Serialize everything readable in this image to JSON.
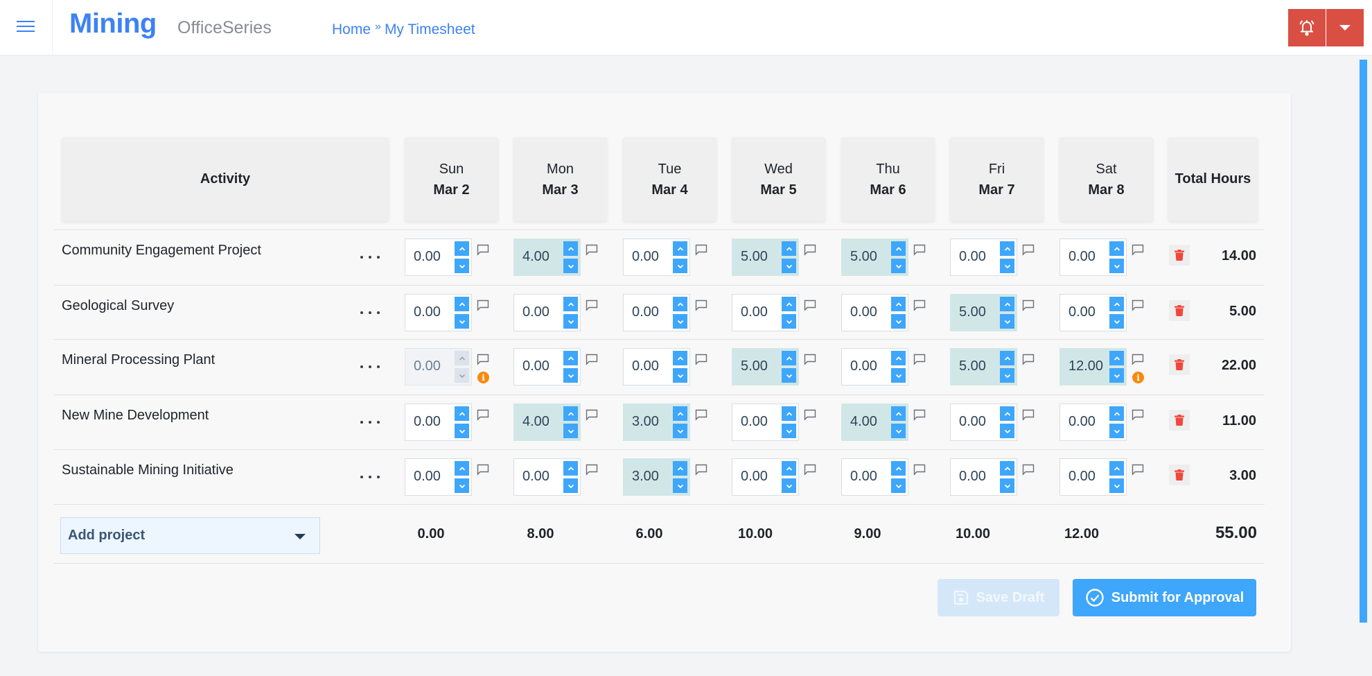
{
  "header": {
    "app_name": "Mining",
    "app_suffix": "OfficeSeries",
    "breadcrumb": [
      {
        "label": "Home"
      },
      {
        "label": "My Timesheet"
      }
    ],
    "breadcrumb_separator": "»",
    "menu_icon": "hamburger-icon",
    "alarm_icon": "alarm-bell-icon",
    "dropdown_icon": "caret-down-icon",
    "accent_color": "#3d82f5",
    "alert_color": "#d94f43"
  },
  "timesheet": {
    "columns": {
      "activity": "Activity",
      "total": "Total Hours",
      "days": [
        {
          "day": "Sun",
          "date": "Mar 2"
        },
        {
          "day": "Mon",
          "date": "Mar 3"
        },
        {
          "day": "Tue",
          "date": "Mar 4"
        },
        {
          "day": "Wed",
          "date": "Mar 5"
        },
        {
          "day": "Thu",
          "date": "Mar 6"
        },
        {
          "day": "Fri",
          "date": "Mar 7"
        },
        {
          "day": "Sat",
          "date": "Mar 8"
        }
      ]
    },
    "rows": [
      {
        "activity": "Community Engagement Project",
        "hours": [
          "0.00",
          "4.00",
          "0.00",
          "5.00",
          "5.00",
          "0.00",
          "0.00"
        ],
        "highlighted": [
          false,
          true,
          false,
          true,
          true,
          false,
          false
        ],
        "disabled": [
          false,
          false,
          false,
          false,
          false,
          false,
          false
        ],
        "warnings": [
          false,
          false,
          false,
          false,
          false,
          false,
          false
        ],
        "total": "14.00"
      },
      {
        "activity": "Geological Survey",
        "hours": [
          "0.00",
          "0.00",
          "0.00",
          "0.00",
          "0.00",
          "5.00",
          "0.00"
        ],
        "highlighted": [
          false,
          false,
          false,
          false,
          false,
          true,
          false
        ],
        "disabled": [
          false,
          false,
          false,
          false,
          false,
          false,
          false
        ],
        "warnings": [
          false,
          false,
          false,
          false,
          false,
          false,
          false
        ],
        "total": "5.00"
      },
      {
        "activity": "Mineral Processing Plant",
        "hours": [
          "0.00",
          "0.00",
          "0.00",
          "5.00",
          "0.00",
          "5.00",
          "12.00"
        ],
        "highlighted": [
          false,
          false,
          false,
          true,
          false,
          true,
          true
        ],
        "disabled": [
          true,
          false,
          false,
          false,
          false,
          false,
          false
        ],
        "warnings": [
          true,
          false,
          false,
          false,
          false,
          false,
          true
        ],
        "total": "22.00"
      },
      {
        "activity": "New Mine Development",
        "hours": [
          "0.00",
          "4.00",
          "3.00",
          "0.00",
          "4.00",
          "0.00",
          "0.00"
        ],
        "highlighted": [
          false,
          true,
          true,
          false,
          true,
          false,
          false
        ],
        "disabled": [
          false,
          false,
          false,
          false,
          false,
          false,
          false
        ],
        "warnings": [
          false,
          false,
          false,
          false,
          false,
          false,
          false
        ],
        "total": "11.00"
      },
      {
        "activity": "Sustainable Mining Initiative",
        "hours": [
          "0.00",
          "0.00",
          "3.00",
          "0.00",
          "0.00",
          "0.00",
          "0.00"
        ],
        "highlighted": [
          false,
          false,
          true,
          false,
          false,
          false,
          false
        ],
        "disabled": [
          false,
          false,
          false,
          false,
          false,
          false,
          false
        ],
        "warnings": [
          false,
          false,
          false,
          false,
          false,
          false,
          false
        ],
        "total": "3.00"
      }
    ],
    "day_totals": [
      "0.00",
      "8.00",
      "6.00",
      "10.00",
      "9.00",
      "10.00",
      "12.00"
    ],
    "grand_total": "55.00",
    "add_project_label": "Add project",
    "row_menu_icon": "more-horizontal-icon",
    "comment_icon": "comment-icon",
    "delete_icon": "trash-icon",
    "warning_icon": "info-icon"
  },
  "actions": {
    "save_draft": "Save Draft",
    "save_draft_icon": "floppy-disk-icon",
    "submit": "Submit for Approval",
    "submit_icon": "check-circle-icon",
    "primary_color": "#3ea6fb"
  }
}
